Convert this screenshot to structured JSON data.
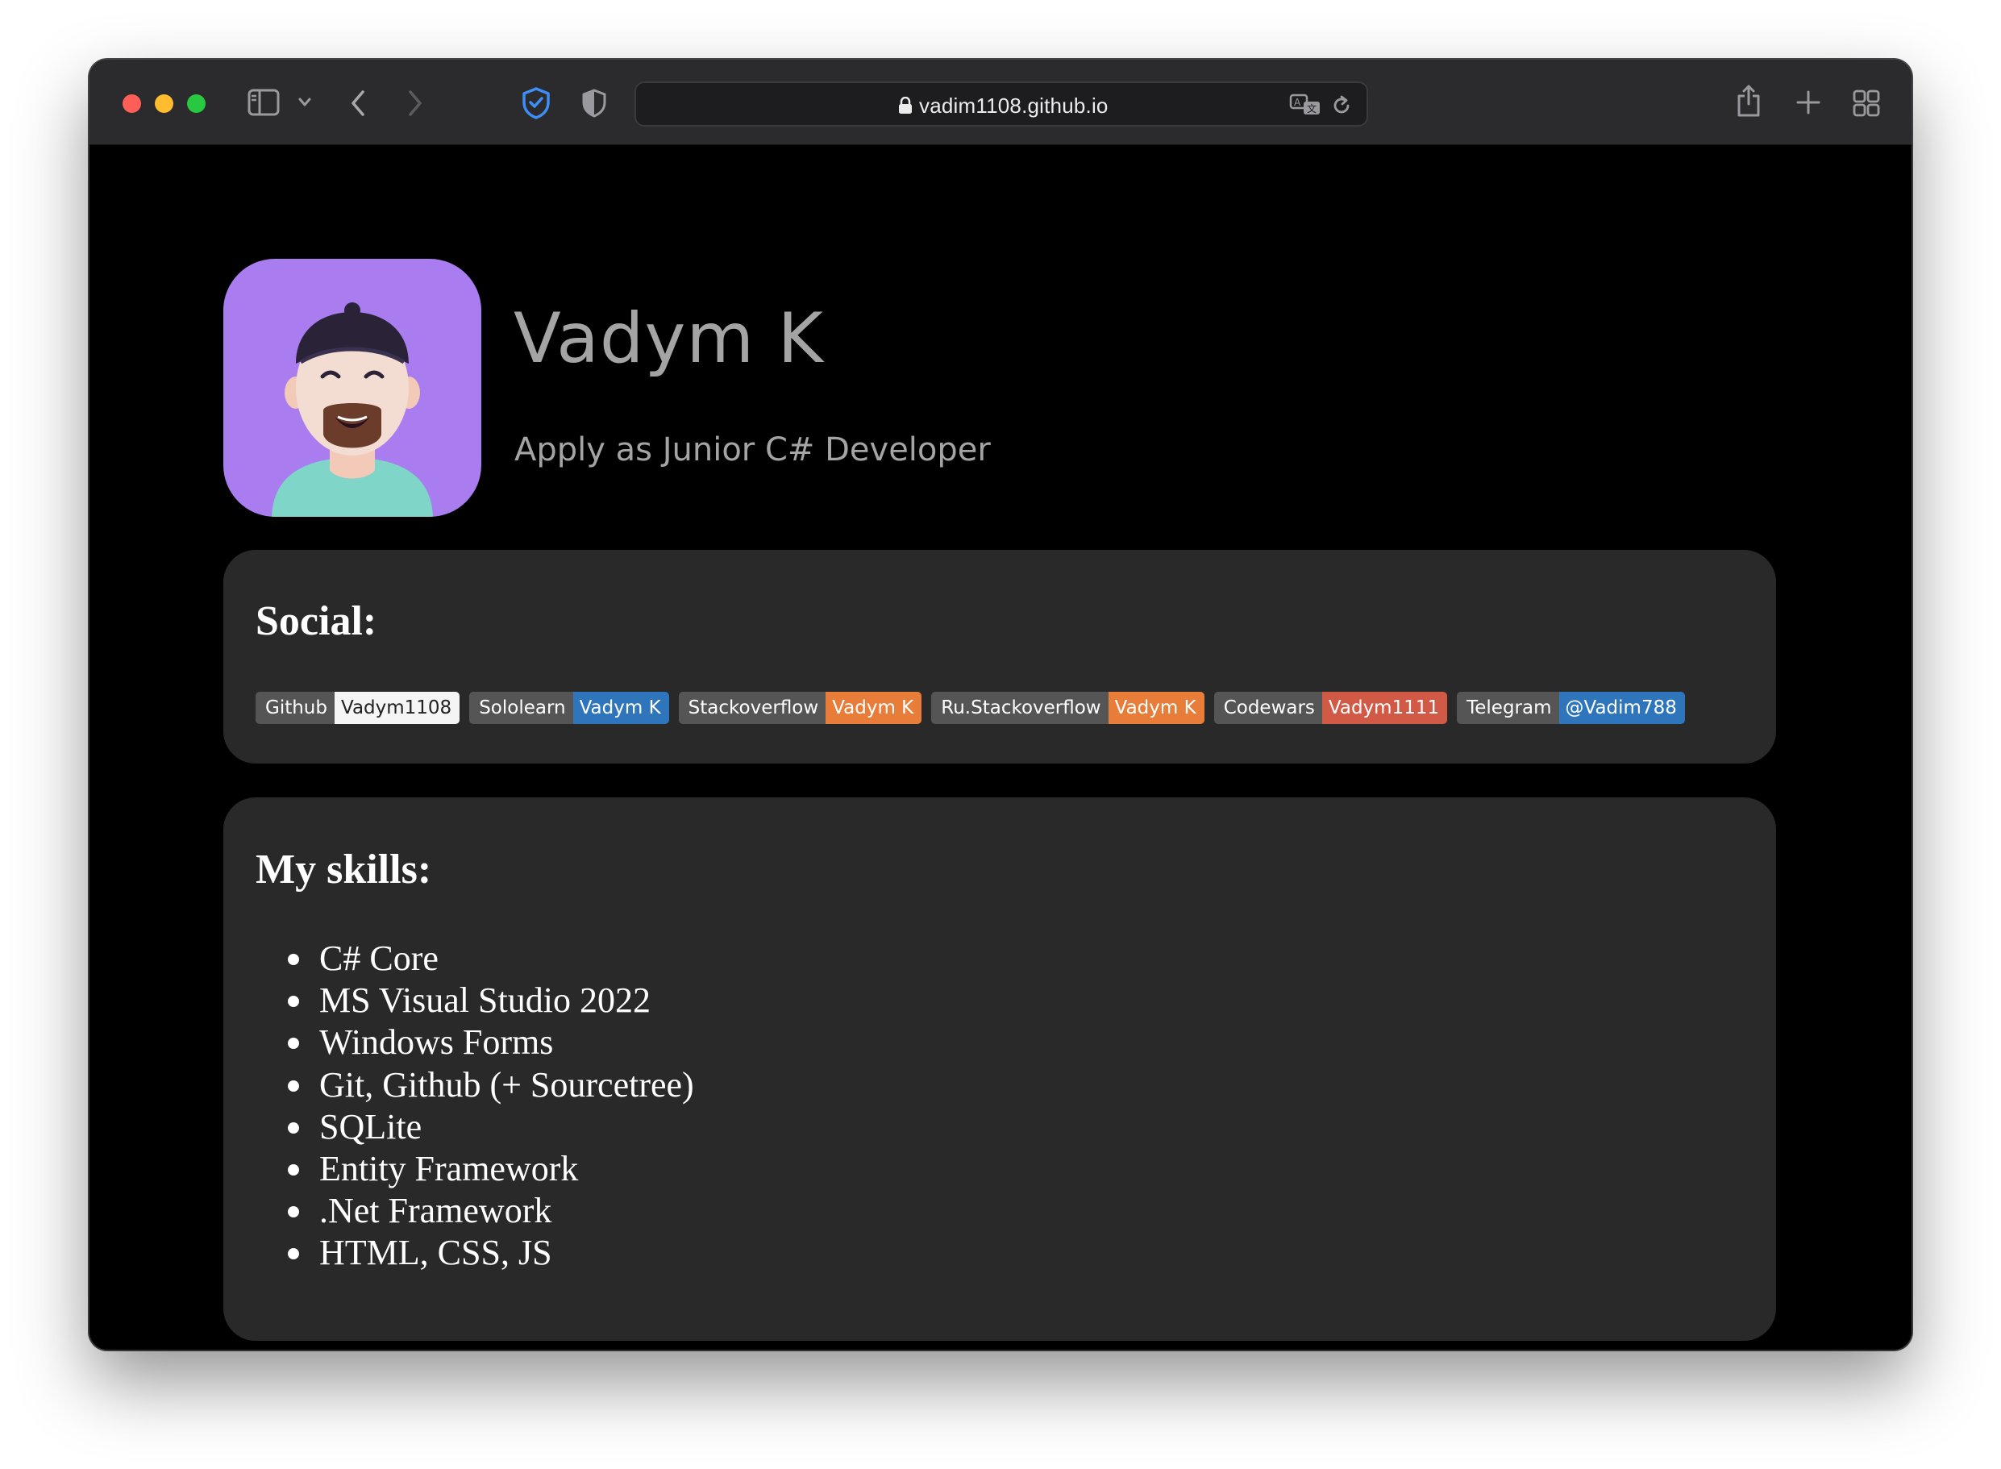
{
  "browser": {
    "url": "vadim1108.github.io"
  },
  "profile": {
    "name": "Vadym K",
    "subtitle": "Apply as Junior C# Developer"
  },
  "social": {
    "title": "Social:",
    "badges": [
      {
        "label": "Github",
        "value": "Vadym1108",
        "color": "#f5f5f5",
        "text_color": "#222222"
      },
      {
        "label": "Sololearn",
        "value": "Vadym K",
        "color": "#2f75bc",
        "text_color": "#ffffff"
      },
      {
        "label": "Stackoverflow",
        "value": "Vadym K",
        "color": "#e87d3a",
        "text_color": "#ffffff"
      },
      {
        "label": "Ru.Stackoverflow",
        "value": "Vadym K",
        "color": "#e87d3a",
        "text_color": "#ffffff"
      },
      {
        "label": "Codewars",
        "value": "Vadym1111",
        "color": "#d05a46",
        "text_color": "#ffffff"
      },
      {
        "label": "Telegram",
        "value": "@Vadim788",
        "color": "#2f75bc",
        "text_color": "#ffffff"
      }
    ]
  },
  "skills": {
    "title": "My skills:",
    "items": [
      "C# Core",
      "MS Visual Studio 2022",
      "Windows Forms",
      "Git, Github (+ Sourcetree)",
      "SQLite",
      "Entity Framework",
      ".Net Framework",
      "HTML, CSS, JS"
    ]
  },
  "icons": {
    "toolbar": [
      "sidebar-icon",
      "chevron-down-icon",
      "back-icon",
      "forward-icon",
      "privacy-shield-icon",
      "shield-icon",
      "lock-icon",
      "translate-icon",
      "reload-icon",
      "share-icon",
      "new-tab-icon",
      "tab-overview-icon"
    ]
  },
  "colors": {
    "avatar_bg": "#a97cef",
    "card_bg": "#292929",
    "page_bg": "#000000"
  }
}
